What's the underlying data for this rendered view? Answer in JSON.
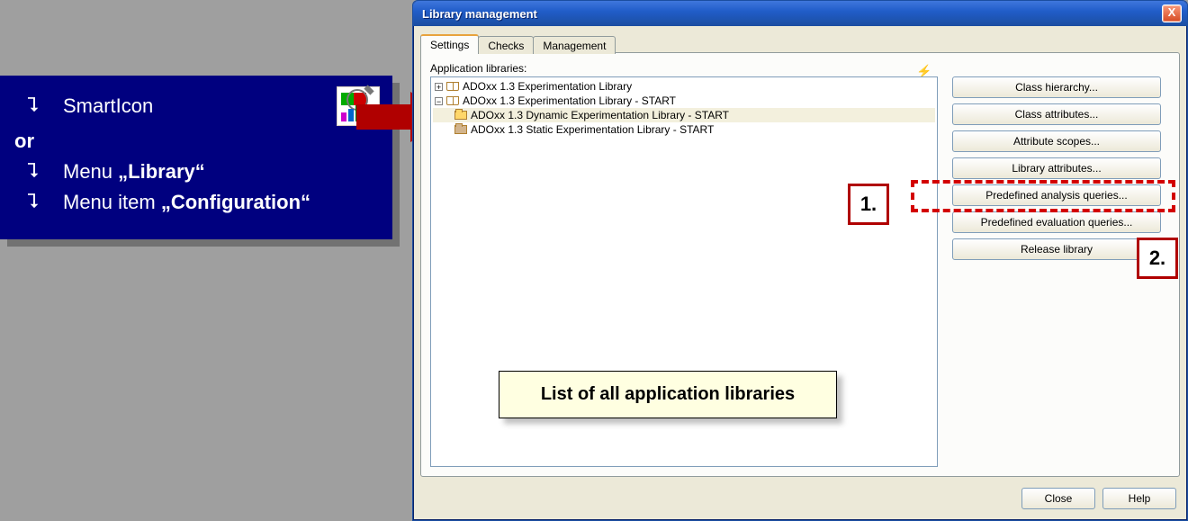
{
  "info": {
    "row1": "SmartIcon",
    "or": "or",
    "row2_pre": "Menu ",
    "row2_bold": "„Library“",
    "row3_pre": "Menu item ",
    "row3_bold": "„Configuration“"
  },
  "window": {
    "title": "Library management",
    "close_x": "X",
    "tabs": {
      "settings": "Settings",
      "checks": "Checks",
      "management": "Management"
    },
    "app_libraries_label": "Application libraries:",
    "tree": {
      "n0": "ADOxx 1.3 Experimentation Library",
      "n1": "ADOxx 1.3 Experimentation Library - START",
      "n1a": "ADOxx 1.3 Dynamic Experimentation Library - START",
      "n1b": "ADOxx 1.3 Static Experimentation Library - START"
    },
    "buttons": {
      "class_hierarchy": "Class hierarchy...",
      "class_attributes": "Class attributes...",
      "attribute_scopes": "Attribute scopes...",
      "library_attributes": "Library attributes...",
      "predef_analysis": "Predefined analysis queries...",
      "predef_evaluation": "Predefined evaluation queries...",
      "release_library": "Release library"
    },
    "bottom": {
      "close": "Close",
      "help": "Help"
    }
  },
  "annotations": {
    "callout": "List of all application libraries",
    "num1": "1.",
    "num2": "2."
  }
}
